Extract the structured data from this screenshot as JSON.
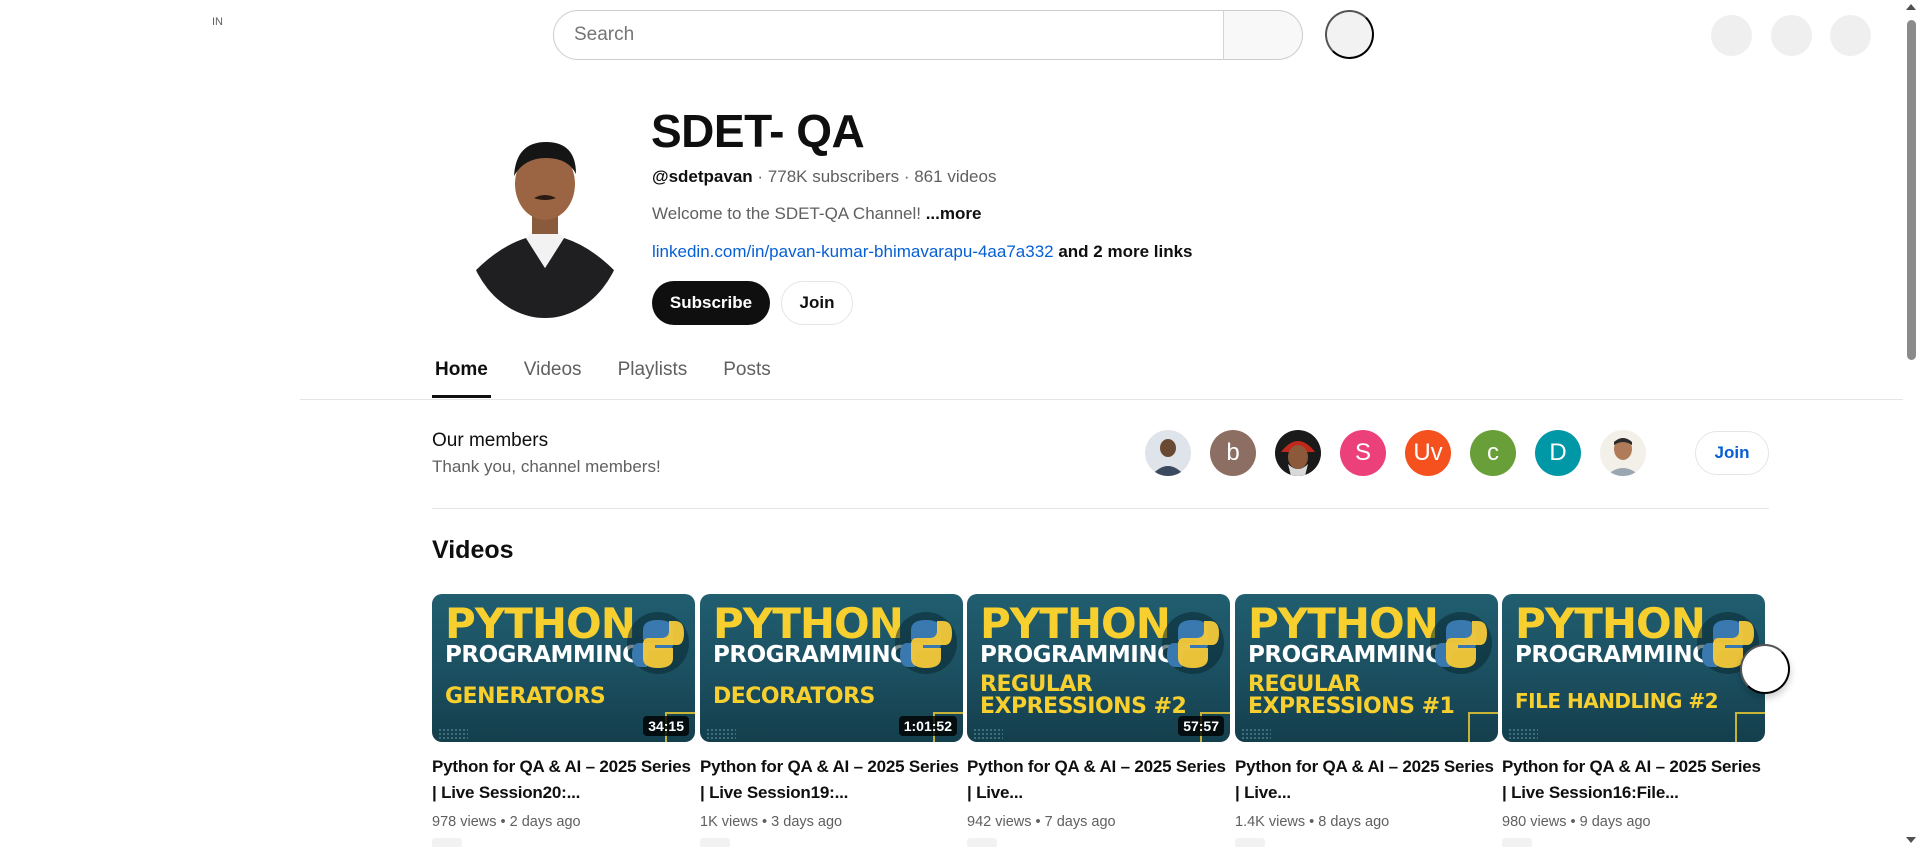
{
  "topbar": {
    "country_code": "IN",
    "search_placeholder": "Search"
  },
  "channel": {
    "name": "SDET- QA",
    "handle": "@sdetpavan",
    "stats": " · 778K subscribers · 861 videos",
    "description": "Welcome to the SDET-QA Channel! ",
    "more_label": "...more",
    "link_text": "linkedin.com/in/pavan-kumar-bhimavarapu-4aa7a332",
    "more_links": " and 2 more links",
    "subscribe_label": "Subscribe",
    "join_label": "Join"
  },
  "tabs": [
    {
      "label": "Home",
      "active": true
    },
    {
      "label": "Videos",
      "active": false
    },
    {
      "label": "Playlists",
      "active": false
    },
    {
      "label": "Posts",
      "active": false
    }
  ],
  "members": {
    "title": "Our members",
    "subtitle": "Thank you, channel members!",
    "join_label": "Join",
    "avatars": [
      {
        "kind": "photo",
        "letter": "",
        "color": "#3b4a5e"
      },
      {
        "kind": "letter",
        "letter": "b",
        "color": "#8d6e63"
      },
      {
        "kind": "photo",
        "letter": "",
        "color": "#7a1f12"
      },
      {
        "kind": "letter",
        "letter": "S",
        "color": "#ec407a"
      },
      {
        "kind": "letter",
        "letter": "Uv",
        "color": "#f4511e"
      },
      {
        "kind": "letter",
        "letter": "c",
        "color": "#689f38"
      },
      {
        "kind": "letter",
        "letter": "D",
        "color": "#0097a7"
      },
      {
        "kind": "photo",
        "letter": "",
        "color": "#c9b8a6"
      }
    ]
  },
  "videos_section": {
    "title": "Videos",
    "items": [
      {
        "thumb_line1": "PYTHON",
        "thumb_line2": "PROGRAMMING",
        "thumb_topic": "GENERATORS",
        "duration": "34:15",
        "title": "Python for QA & AI – 2025 Series | Live Session20:...",
        "views": "978 views",
        "age": "2 days ago"
      },
      {
        "thumb_line1": "PYTHON",
        "thumb_line2": "PROGRAMMING",
        "thumb_topic": "DECORATORS",
        "duration": "1:01:52",
        "title": "Python for QA & AI – 2025 Series | Live Session19:...",
        "views": "1K views",
        "age": "3 days ago"
      },
      {
        "thumb_line1": "PYTHON",
        "thumb_line2": "PROGRAMMING",
        "thumb_topic": "REGULAR\nEXPRESSIONS #2",
        "duration": "57:57",
        "title": "Python for QA & AI – 2025 Series | Live...",
        "views": "942 views",
        "age": "7 days ago"
      },
      {
        "thumb_line1": "PYTHON",
        "thumb_line2": "PROGRAMMING",
        "thumb_topic": "REGULAR\nEXPRESSIONS #1",
        "duration": "",
        "title": "Python for QA & AI – 2025 Series | Live...",
        "views": "1.4K views",
        "age": "8 days ago"
      },
      {
        "thumb_line1": "PYTHON",
        "thumb_line2": "PROGRAMMING",
        "thumb_topic": "FILE HANDLING #2",
        "duration": "",
        "title": "Python for QA & AI – 2025 Series | Live Session16:File...",
        "views": "980 views",
        "age": "9 days ago"
      }
    ]
  },
  "colors": {
    "accent_blue": "#065fd4",
    "thumb_yellow": "#f7d030",
    "thumb_teal": "#205e70"
  }
}
